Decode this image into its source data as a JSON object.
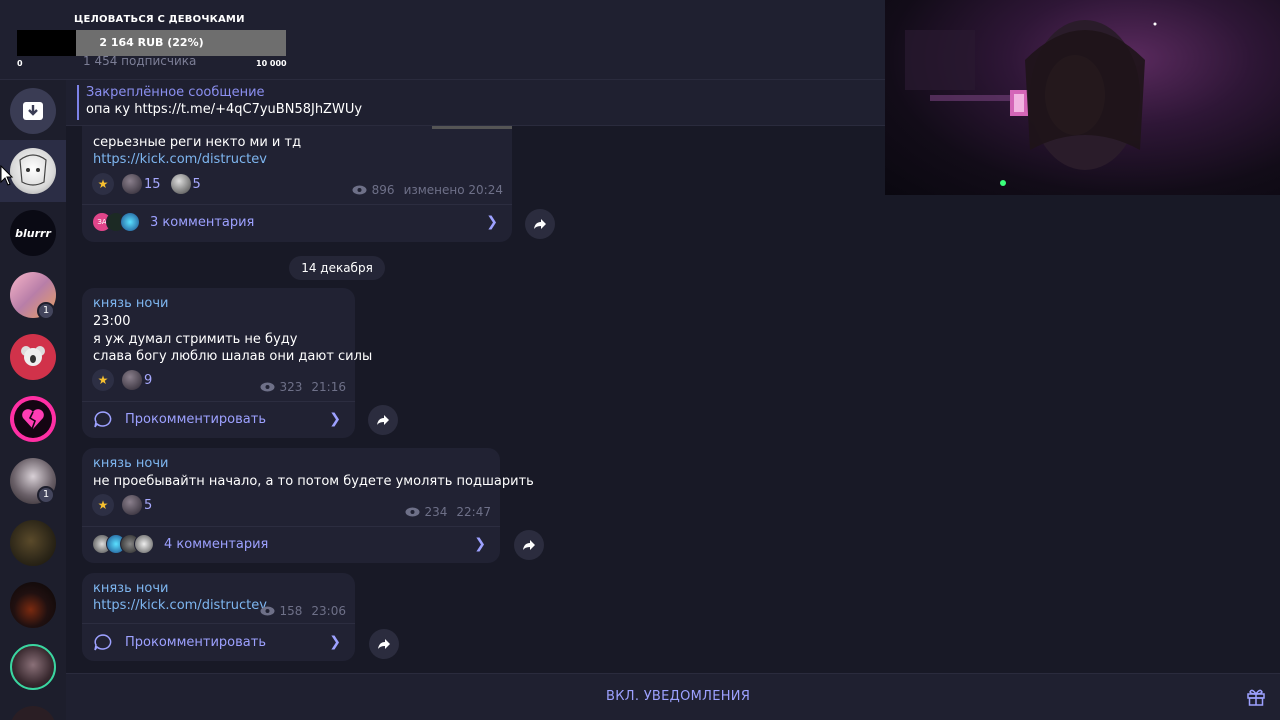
{
  "donation": {
    "title": "ЦЕЛОВАТЬСЯ С ДЕВОЧКАМИ",
    "amount": "2 164 RUB (22%)",
    "progress": 0.22,
    "min": "0",
    "max": "10 000"
  },
  "header": {
    "subscribers": "1 454 подписчика"
  },
  "pinned": {
    "title": "Закреплённое сообщение",
    "text": "опа ку https://t.me/+4qC7yuBN58JhZWUy"
  },
  "sidebar": {
    "items": [
      {
        "name": "archive-icon"
      },
      {
        "name": "channel-anime-avatar"
      },
      {
        "name": "channel-blurrr",
        "label": "blurrr"
      },
      {
        "name": "channel-pink-avatar",
        "badge": "1"
      },
      {
        "name": "channel-koala-avatar"
      },
      {
        "name": "channel-broken-heart-avatar"
      },
      {
        "name": "channel-girl-avatar",
        "badge": "1"
      },
      {
        "name": "channel-forest-avatar"
      },
      {
        "name": "channel-dark-avatar"
      },
      {
        "name": "channel-face-avatar"
      }
    ]
  },
  "messages": [
    {
      "text": "серьезные реги некто ми и тд",
      "link": "https://kick.com/distructev",
      "reactions": [
        {
          "icon": "star"
        },
        {
          "count": "15"
        },
        {
          "count": "5"
        }
      ],
      "views": "896",
      "time": "изменено 20:24",
      "comments": "3 комментария",
      "commenter_initials": "ЗА"
    },
    {
      "author": "князь ночи",
      "text": "23:00\nя уж думал стримить не буду\nслава богу люблю шалав они дают силы",
      "reactions": [
        {
          "icon": "star"
        },
        {
          "count": "9"
        }
      ],
      "views": "323",
      "time": "21:16",
      "comments": "Прокомментировать"
    },
    {
      "author": "князь ночи",
      "text": "не проебывайтн начало, а то потом будете умолять подшарить",
      "reactions": [
        {
          "icon": "star"
        },
        {
          "count": "5"
        }
      ],
      "views": "234",
      "time": "22:47",
      "comments": "4 комментария"
    },
    {
      "author": "князь ночи",
      "link": "https://kick.com/distructev",
      "views": "158",
      "time": "23:06",
      "comments": "Прокомментировать"
    }
  ],
  "date_divider": "14 декабря",
  "footer": {
    "button": "ВКЛ. УВЕДОМЛЕНИЯ"
  },
  "colors": {
    "accent": "#9da1ff",
    "link": "#7eb6f0",
    "bg": "#181926",
    "bubble": "#212233"
  }
}
